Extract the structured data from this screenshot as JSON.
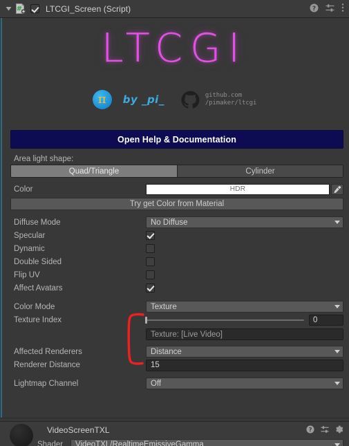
{
  "header": {
    "title": "LTCGI_Screen (Script)",
    "enabled_checkbox": true,
    "foldout_expanded": true,
    "icons": [
      "script-icon",
      "help-icon",
      "preset-icon",
      "menu-icon"
    ]
  },
  "logo": {
    "wordmark": "LTCGI",
    "wordmark_color": "#e34fe6",
    "pi_symbol": "π",
    "byline": "by _pi_",
    "byline_color": "#3fa9e0",
    "github_line1": "github.com",
    "github_line2": "/pimaker/ltcgi"
  },
  "help_button": {
    "label": "Open Help & Documentation",
    "background": "#0d0c52"
  },
  "shape": {
    "label": "Area light shape:",
    "options": [
      "Quad/Triangle",
      "Cylinder"
    ],
    "selected": "Quad/Triangle"
  },
  "color": {
    "label": "Color",
    "swatch_text": "HDR",
    "swatch_color": "#ffffff",
    "eyedropper": "eyedropper-icon",
    "material_button": "Try get Color from Material"
  },
  "properties": [
    {
      "label": "Diffuse Mode",
      "type": "dropdown",
      "value": "No Diffuse"
    },
    {
      "label": "Specular",
      "type": "checkbox",
      "value": true
    },
    {
      "label": "Dynamic",
      "type": "checkbox",
      "value": false
    },
    {
      "label": "Double Sided",
      "type": "checkbox",
      "value": false
    },
    {
      "label": "Flip UV",
      "type": "checkbox",
      "value": false
    },
    {
      "label": "Affect Avatars",
      "type": "checkbox",
      "value": true
    }
  ],
  "texture_group": {
    "color_mode_label": "Color Mode",
    "color_mode_value": "Texture",
    "texture_index_label": "Texture Index",
    "texture_index_value": "0",
    "texture_field_value": "Texture: [Live Video]",
    "annotation_color": "#ef2020"
  },
  "renderers": {
    "affected_label": "Affected Renderers",
    "affected_value": "Distance",
    "distance_label": "Renderer Distance",
    "distance_value": "15",
    "lightmap_label": "Lightmap Channel",
    "lightmap_value": "Off"
  },
  "material": {
    "name": "VideoScreenTXL",
    "shader_label": "Shader",
    "shader_value": "VideoTXL/RealtimeEmissiveGamma",
    "icons": [
      "help-icon",
      "preset-icon",
      "gear-icon"
    ]
  }
}
